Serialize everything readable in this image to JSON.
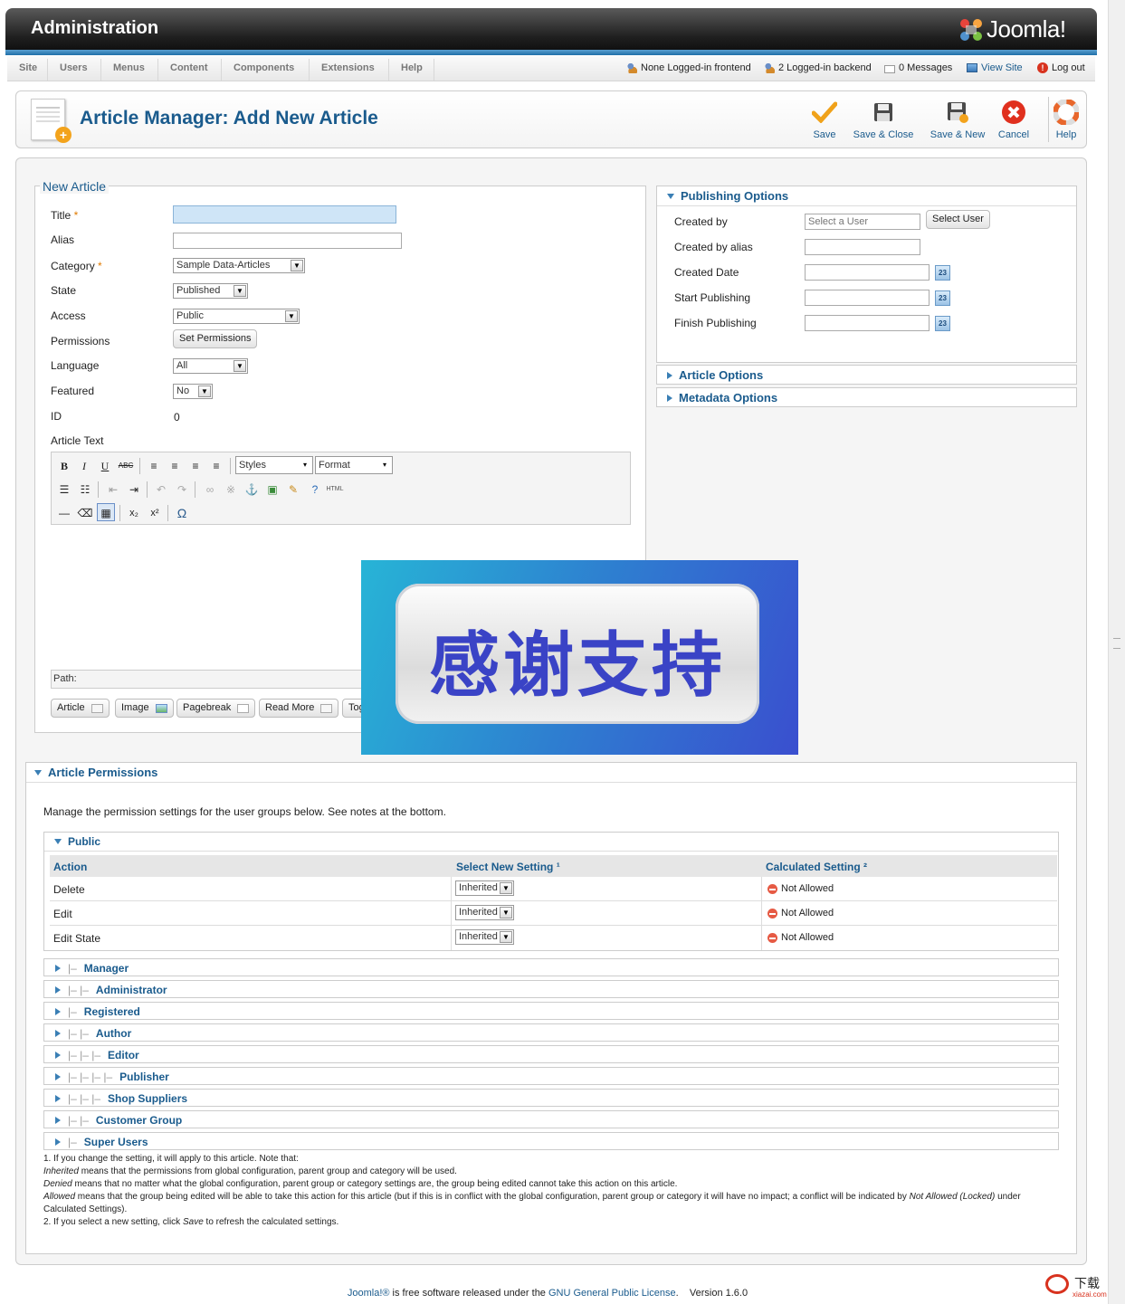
{
  "header": {
    "title": "Administration",
    "logo_text": "Joomla!"
  },
  "menu": {
    "items": [
      "Site",
      "Users",
      "Menus",
      "Content",
      "Components",
      "Extensions",
      "Help"
    ],
    "status": {
      "frontend": "None Logged-in frontend",
      "backend": "2 Logged-in backend",
      "messages": "0 Messages",
      "view_site": "View Site",
      "logout": "Log out"
    }
  },
  "toolbar": {
    "page_title": "Article Manager: Add New Article",
    "save": "Save",
    "save_close": "Save & Close",
    "save_new": "Save & New",
    "cancel": "Cancel",
    "help": "Help"
  },
  "form": {
    "legend": "New Article",
    "title_label": "Title",
    "title_value": "",
    "alias_label": "Alias",
    "alias_value": "",
    "category_label": "Category",
    "category_value": "Sample Data-Articles",
    "state_label": "State",
    "state_value": "Published",
    "access_label": "Access",
    "access_value": "Public",
    "permissions_label": "Permissions",
    "permissions_button": "Set Permissions",
    "language_label": "Language",
    "language_value": "All",
    "featured_label": "Featured",
    "featured_value": "No",
    "id_label": "ID",
    "id_value": "0",
    "article_text_label": "Article Text",
    "required_mark": "*"
  },
  "editor": {
    "styles": "Styles",
    "format": "Format",
    "path_label": "Path:",
    "buttons": {
      "article": "Article",
      "image": "Image",
      "pagebreak": "Pagebreak",
      "readmore": "Read More",
      "toggle": "Tog"
    }
  },
  "overlay": {
    "text": "感谢支持"
  },
  "publishing": {
    "title": "Publishing Options",
    "created_by_label": "Created by",
    "created_by_placeholder": "Select a User",
    "select_user_button": "Select User",
    "created_by_alias_label": "Created by alias",
    "created_date_label": "Created Date",
    "start_publishing_label": "Start Publishing",
    "finish_publishing_label": "Finish Publishing",
    "calendar_icon_text": "23"
  },
  "article_options_title": "Article Options",
  "metadata_options_title": "Metadata Options",
  "permissions": {
    "title": "Article Permissions",
    "description": "Manage the permission settings for the user groups below. See notes at the bottom.",
    "public_group": "Public",
    "col_action": "Action",
    "col_select": "Select New Setting ¹",
    "col_calculated": "Calculated Setting ²",
    "rows": [
      {
        "action": "Delete",
        "setting": "Inherited",
        "calculated": "Not Allowed"
      },
      {
        "action": "Edit",
        "setting": "Inherited",
        "calculated": "Not Allowed"
      },
      {
        "action": "Edit State",
        "setting": "Inherited",
        "calculated": "Not Allowed"
      }
    ],
    "groups": [
      {
        "indent": "|–",
        "name": "Manager"
      },
      {
        "indent": "|– |–",
        "name": "Administrator"
      },
      {
        "indent": "|–",
        "name": "Registered"
      },
      {
        "indent": "|– |–",
        "name": "Author"
      },
      {
        "indent": "|– |– |–",
        "name": "Editor"
      },
      {
        "indent": "|– |– |– |–",
        "name": "Publisher"
      },
      {
        "indent": "|– |– |–",
        "name": "Shop Suppliers"
      },
      {
        "indent": "|– |–",
        "name": "Customer Group"
      },
      {
        "indent": "|–",
        "name": "Super Users"
      }
    ],
    "notes": {
      "n1": "1. If you change the setting, it will apply to this article. Note that:",
      "inherited_term": "Inherited",
      "inherited_text": " means that the permissions from global configuration, parent group and category will be used.",
      "denied_term": "Denied",
      "denied_text": " means that no matter what the global configuration, parent group or category settings are, the group being edited cannot take this action on this article.",
      "allowed_term": "Allowed",
      "allowed_text": " means that the group being edited will be able to take this action for this article (but if this is in conflict with the global configuration, parent group or category it will have no impact; a conflict will be indicated by ",
      "allowed_locked": "Not Allowed (Locked)",
      "allowed_tail": " under Calculated Settings).",
      "n2_pre": "2. If you select a new setting, click ",
      "n2_save": "Save",
      "n2_post": " to refresh the calculated settings."
    }
  },
  "footer": {
    "joomla": "Joomla!®",
    "text1": " is free software released under the ",
    "license": "GNU General Public License",
    "text2": ".    Version 1.6.0"
  },
  "watermark": {
    "brand": "下载",
    "domain": "xiazai.com"
  }
}
